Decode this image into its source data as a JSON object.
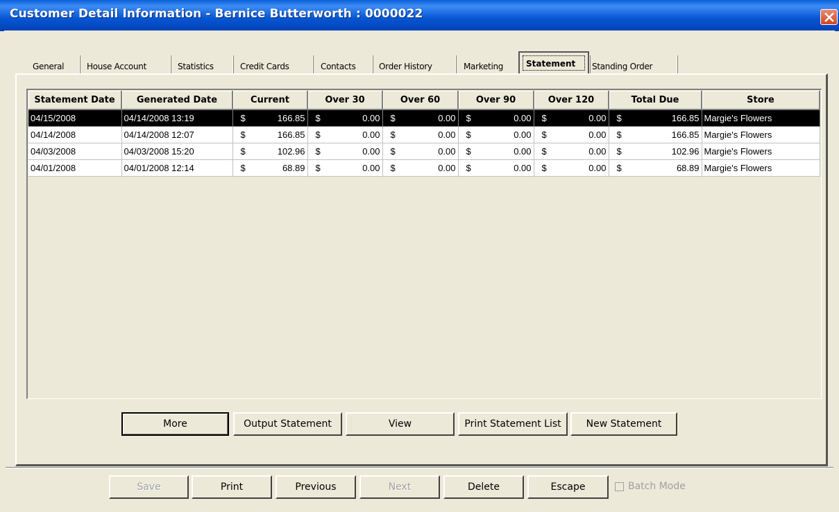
{
  "window": {
    "title": "Customer Detail Information - Bernice Butterworth : 0000022"
  },
  "tabs": [
    {
      "label": "General"
    },
    {
      "label": "House Account"
    },
    {
      "label": "Statistics"
    },
    {
      "label": "Credit Cards"
    },
    {
      "label": "Contacts"
    },
    {
      "label": "Order History"
    },
    {
      "label": "Marketing"
    },
    {
      "label": "Statement",
      "active": true
    },
    {
      "label": "Standing Order"
    }
  ],
  "grid": {
    "columns": [
      "Statement Date",
      "Generated Date",
      "Current",
      "Over 30",
      "Over 60",
      "Over 90",
      "Over 120",
      "Total Due",
      "Store"
    ],
    "rows": [
      {
        "statement_date": "04/15/2008",
        "generated_date": "04/14/2008 13:19",
        "current": "166.85",
        "over30": "0.00",
        "over60": "0.00",
        "over90": "0.00",
        "over120": "0.00",
        "total_due": "166.85",
        "store": "Margie's Flowers",
        "selected": true
      },
      {
        "statement_date": "04/14/2008",
        "generated_date": "04/14/2008 12:07",
        "current": "166.85",
        "over30": "0.00",
        "over60": "0.00",
        "over90": "0.00",
        "over120": "0.00",
        "total_due": "166.85",
        "store": "Margie's Flowers"
      },
      {
        "statement_date": "04/03/2008",
        "generated_date": "04/03/2008 15:20",
        "current": "102.96",
        "over30": "0.00",
        "over60": "0.00",
        "over90": "0.00",
        "over120": "0.00",
        "total_due": "102.96",
        "store": "Margie's Flowers"
      },
      {
        "statement_date": "04/01/2008",
        "generated_date": "04/01/2008 12:14",
        "current": "68.89",
        "over30": "0.00",
        "over60": "0.00",
        "over90": "0.00",
        "over120": "0.00",
        "total_due": "68.89",
        "store": "Margie's Flowers"
      }
    ],
    "currency_symbol": "$"
  },
  "panel_buttons": {
    "more": "More",
    "output_statement": "Output Statement",
    "view": "View",
    "print_statement_list": "Print Statement List",
    "new_statement": "New Statement"
  },
  "footer_buttons": {
    "save": "Save",
    "print": "Print",
    "previous": "Previous",
    "next": "Next",
    "delete": "Delete",
    "escape": "Escape"
  },
  "batch_mode": {
    "label": "Batch Mode",
    "checked": false,
    "enabled": false
  },
  "colors": {
    "titlebar": "#0a5fd8",
    "face": "#ece9d8",
    "selected_row": "#000000",
    "close_button": "#d3451f"
  }
}
